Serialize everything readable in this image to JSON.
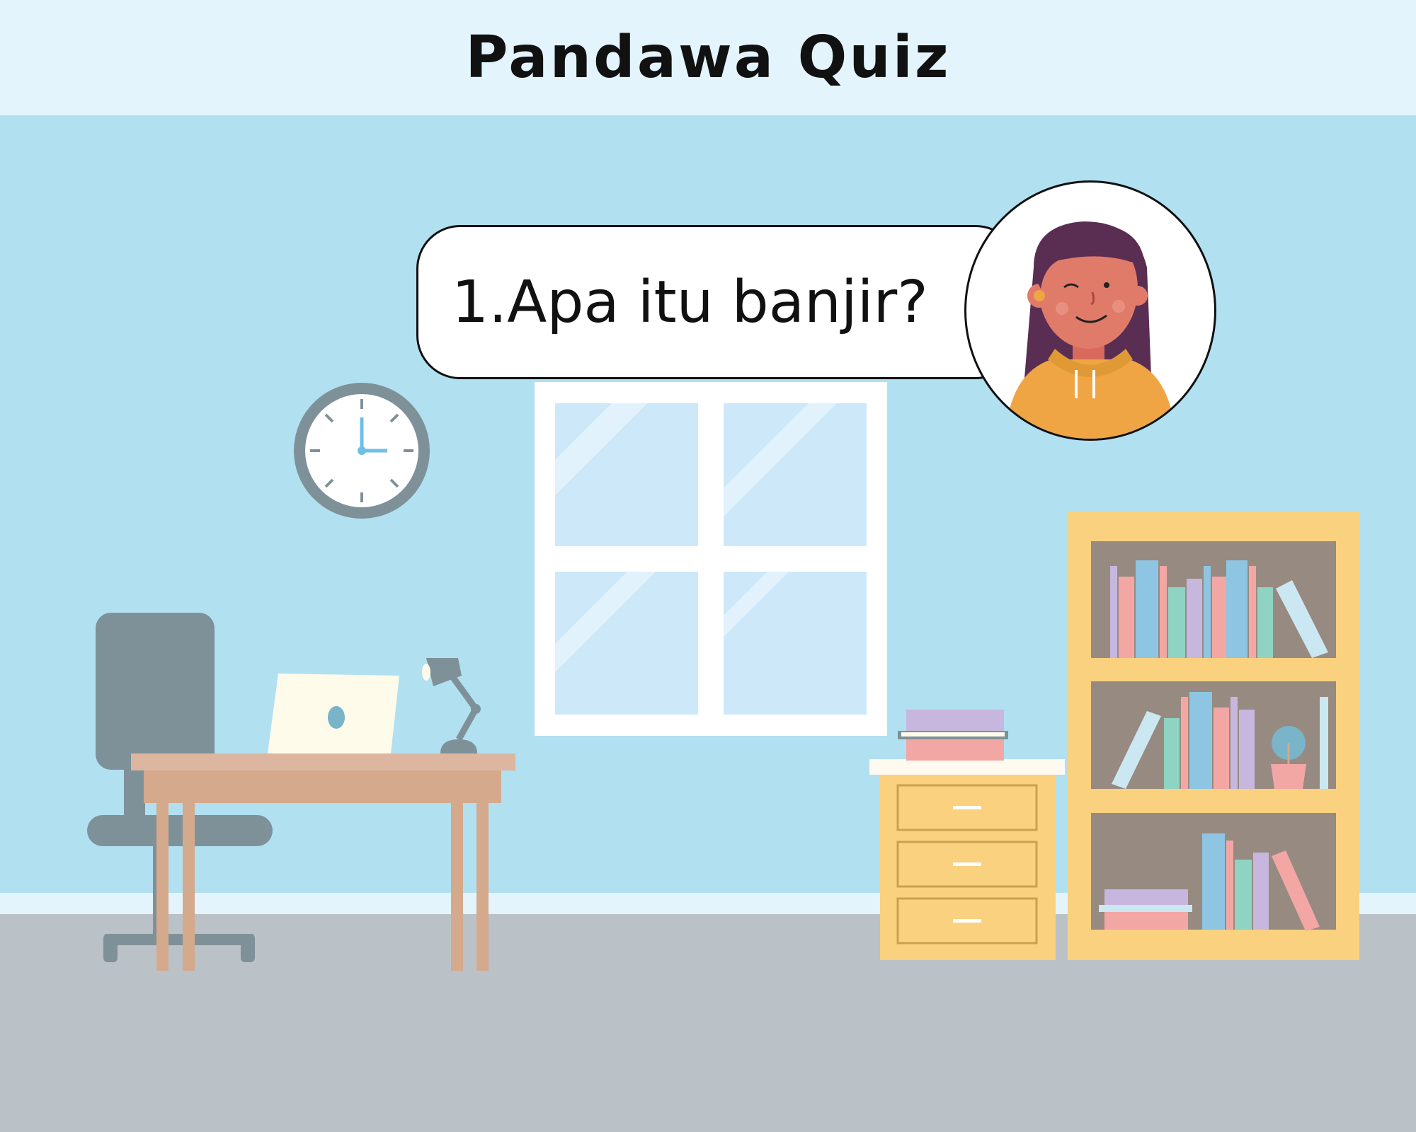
{
  "app": {
    "title": "Pandawa Quiz"
  },
  "question": {
    "text": "1.Apa itu banjir?"
  },
  "character": {
    "icon": "girl-avatar-icon"
  },
  "colors": {
    "header_bg": "#e3f4fd",
    "wall": "#b1e0f1",
    "floor": "#bac1c7",
    "shelf": "#f9d17f",
    "desk": "#dcb69e",
    "chair": "#7f9198"
  }
}
